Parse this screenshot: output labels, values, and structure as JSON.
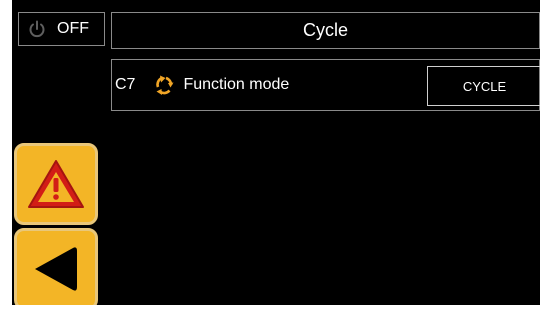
{
  "power": {
    "label": "OFF",
    "icon": "power-icon"
  },
  "header": {
    "title": "Cycle"
  },
  "parameter": {
    "code": "C7",
    "icon": "cycle-arrows-icon",
    "label": "Function mode",
    "value": "CYCLE"
  },
  "sidebar": {
    "alarm_icon": "warning-triangle-icon",
    "back_icon": "back-arrow-icon"
  },
  "colors": {
    "background": "#000000",
    "button_yellow": "#f3b526",
    "warning_red": "#d21d16",
    "border_gray": "#8a8a8a"
  }
}
